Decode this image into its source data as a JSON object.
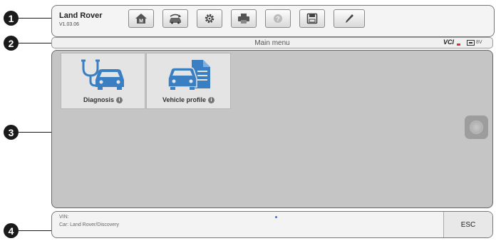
{
  "callouts": [
    "1",
    "2",
    "3",
    "4"
  ],
  "toolbar": {
    "title": "Land Rover",
    "version": "V1.03.06",
    "buttons": [
      "home-icon",
      "vehicle-swap-icon",
      "settings-icon",
      "print-icon",
      "help-icon",
      "save-icon",
      "data-logging-icon"
    ]
  },
  "statusbar": {
    "title": "Main menu",
    "vci_label": "VCI",
    "voltage": "8V"
  },
  "main": {
    "tiles": [
      {
        "label": "Diagnosis",
        "icon": "stethoscope-car-icon",
        "info": "i"
      },
      {
        "label": "Vehicle profile",
        "icon": "car-document-icon",
        "info": "i"
      }
    ]
  },
  "bottombar": {
    "vin": "VIN:",
    "car": "Car: Land Rover/Discovery",
    "esc_label": "ESC"
  },
  "colors": {
    "icon_blue": "#3a7fc2",
    "main_bg": "#c5c5c5",
    "callout": "#1a1a1a",
    "page_dot": "#4472c4",
    "vci_dot": "#dd3333"
  }
}
